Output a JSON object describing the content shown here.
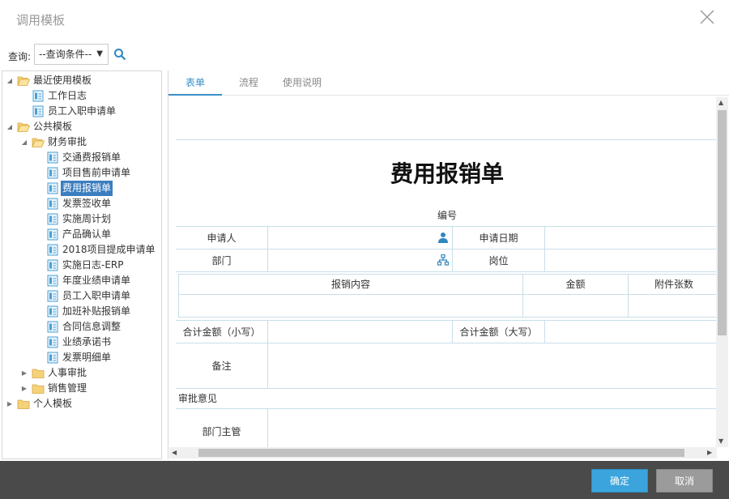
{
  "dialog": {
    "title": "调用模板"
  },
  "query": {
    "label": "查询:",
    "select_value": "--查询条件--"
  },
  "tree": {
    "items": [
      {
        "label": "最近使用模板",
        "type": "folder-open",
        "toggle": "▲"
      },
      {
        "label": "工作日志",
        "type": "doc"
      },
      {
        "label": "员工入职申请单",
        "type": "doc"
      },
      {
        "label": "公共模板",
        "type": "folder-open",
        "toggle": "▲"
      },
      {
        "label": "财务审批",
        "type": "folder-open",
        "toggle": "▲"
      },
      {
        "label": "交通费报销单",
        "type": "doc"
      },
      {
        "label": "项目售前申请单",
        "type": "doc"
      },
      {
        "label": "费用报销单",
        "type": "doc",
        "selected": true
      },
      {
        "label": "发票签收单",
        "type": "doc"
      },
      {
        "label": "实施周计划",
        "type": "doc"
      },
      {
        "label": "产品确认单",
        "type": "doc"
      },
      {
        "label": "2018项目提成申请单",
        "type": "doc"
      },
      {
        "label": "实施日志-ERP",
        "type": "doc"
      },
      {
        "label": "年度业绩申请单",
        "type": "doc"
      },
      {
        "label": "员工入职申请单",
        "type": "doc"
      },
      {
        "label": "加班补贴报销单",
        "type": "doc"
      },
      {
        "label": "合同信息调整",
        "type": "doc"
      },
      {
        "label": "业绩承诺书",
        "type": "doc"
      },
      {
        "label": "发票明细单",
        "type": "doc"
      },
      {
        "label": "人事审批",
        "type": "folder",
        "toggle": "▶"
      },
      {
        "label": "销售管理",
        "type": "folder",
        "toggle": "▶"
      },
      {
        "label": "个人模板",
        "type": "folder",
        "toggle": "▶"
      }
    ]
  },
  "tabs": [
    {
      "label": "表单",
      "active": true
    },
    {
      "label": "流程"
    },
    {
      "label": "使用说明"
    }
  ],
  "form": {
    "title": "费用报销单",
    "serial_label": "编号",
    "applicant_label": "申请人",
    "apply_date_label": "申请日期",
    "department_label": "部门",
    "position_label": "岗位",
    "detail_headers": [
      "报销内容",
      "金额",
      "附件张数"
    ],
    "total_lower_label": "合计金额（小写）",
    "total_upper_label": "合计金额（大写）",
    "remark_label": "备注",
    "approval_label": "审批意见",
    "dept_manager_label": "部门主管"
  },
  "footer": {
    "ok_label": "确定",
    "cancel_label": "取消"
  },
  "colors": {
    "accent": "#3ba4dc",
    "selected": "#3b7ec0",
    "footer_bg": "#4a4a4a"
  }
}
